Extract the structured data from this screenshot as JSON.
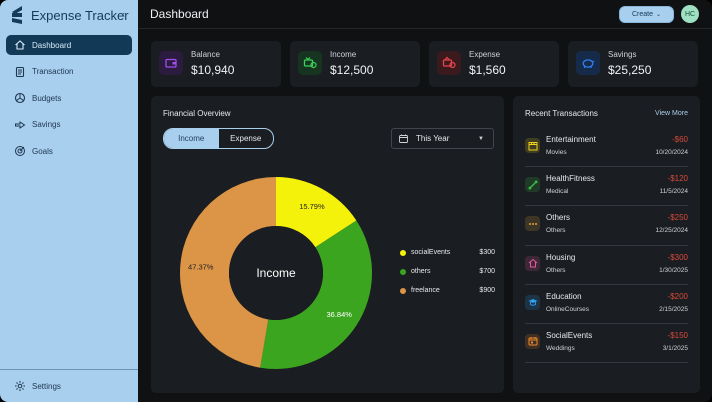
{
  "app": {
    "title": "Expense Tracker",
    "collapse_glyph": "‹"
  },
  "sidebar": {
    "items": [
      {
        "label": "Dashboard",
        "icon": "home-icon",
        "active": true
      },
      {
        "label": "Transaction",
        "icon": "receipt-icon"
      },
      {
        "label": "Budgets",
        "icon": "pie-icon"
      },
      {
        "label": "Savings",
        "icon": "trend-icon"
      },
      {
        "label": "Goals",
        "icon": "target-icon"
      }
    ],
    "settings_label": "Settings"
  },
  "header": {
    "title": "Dashboard",
    "create_label": "Create",
    "avatar_initials": "HC"
  },
  "stats": [
    {
      "label": "Balance",
      "value": "$10,940",
      "icon": "wallet-icon",
      "color": "#a24df0"
    },
    {
      "label": "Income",
      "value": "$12,500",
      "icon": "income-icon",
      "color": "#3ccf5a"
    },
    {
      "label": "Expense",
      "value": "$1,560",
      "icon": "expense-icon",
      "color": "#e8434e"
    },
    {
      "label": "Savings",
      "value": "$25,250",
      "icon": "piggy-icon",
      "color": "#2f7df0"
    }
  ],
  "overview": {
    "title": "Financial Overview",
    "toggle": {
      "income": "Income",
      "expense": "Expense",
      "selected": "Income"
    },
    "period": "This Year"
  },
  "chart_data": {
    "type": "pie",
    "center_label": "Income",
    "categories": [
      "socialEvents",
      "others",
      "freelance"
    ],
    "values": [
      300,
      700,
      900
    ],
    "percent_labels": [
      "15.79%",
      "36.84%",
      "47.37%"
    ],
    "amount_labels": [
      "$300",
      "$700",
      "$900"
    ],
    "colors": [
      "#f4f10a",
      "#3ca51f",
      "#dc9446"
    ],
    "legend_position": "right"
  },
  "recent": {
    "title": "Recent Transactions",
    "view_more": "View More",
    "items": [
      {
        "name": "Entertainment",
        "sub": "Movies",
        "amount": "-$60",
        "date": "10/20/2024",
        "icon": "clapper-icon",
        "color": "#f1d21a"
      },
      {
        "name": "HealthFitness",
        "sub": "Medical",
        "amount": "-$120",
        "date": "11/5/2024",
        "icon": "dumbbell-icon",
        "color": "#3cc24a"
      },
      {
        "name": "Others",
        "sub": "Others",
        "amount": "-$250",
        "date": "12/25/2024",
        "icon": "dots-icon",
        "color": "#e0a43a"
      },
      {
        "name": "Housing",
        "sub": "Others",
        "amount": "-$300",
        "date": "1/30/2025",
        "icon": "house-icon",
        "color": "#e35a9c"
      },
      {
        "name": "Education",
        "sub": "OnlineCourses",
        "amount": "-$200",
        "date": "2/15/2025",
        "icon": "graduation-cap-icon",
        "color": "#2f9ff0"
      },
      {
        "name": "SocialEvents",
        "sub": "Weddings",
        "amount": "-$150",
        "date": "3/1/2025",
        "icon": "calendar-icon",
        "color": "#ee8a2a"
      }
    ]
  }
}
